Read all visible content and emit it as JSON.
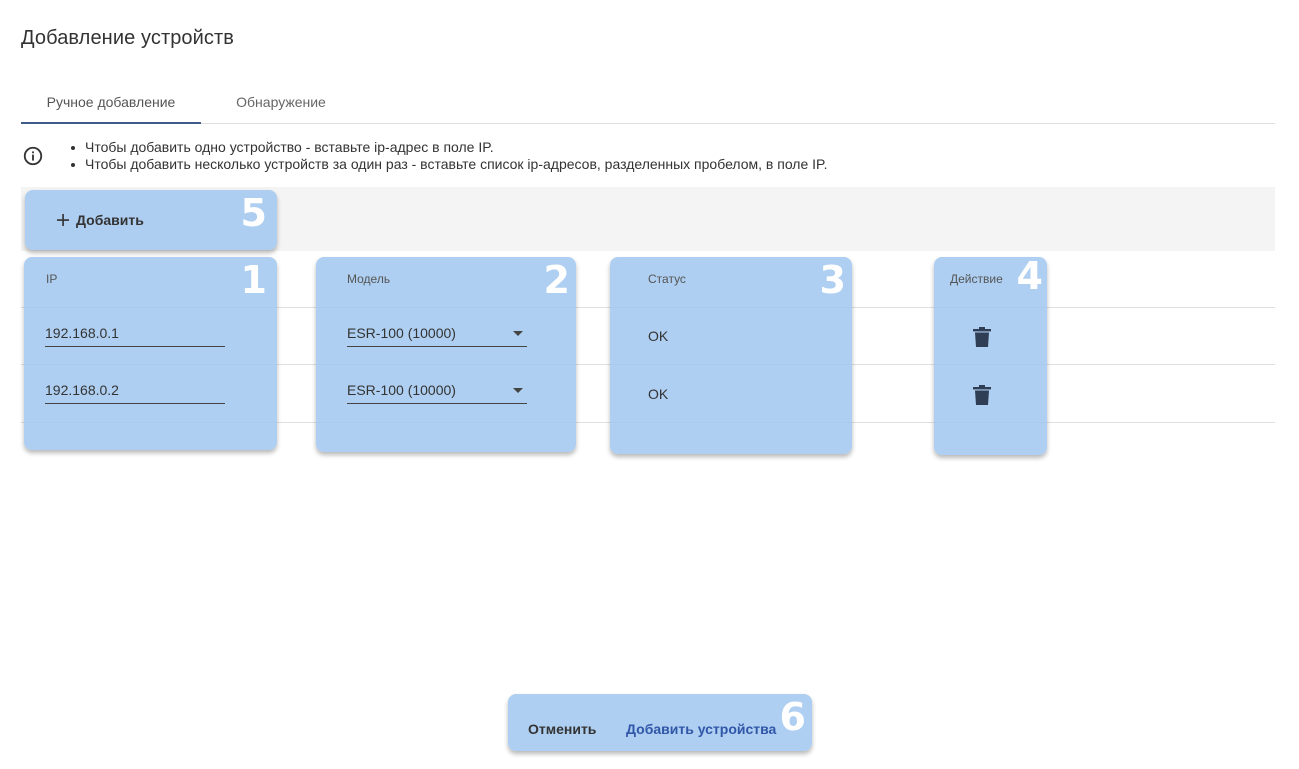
{
  "dialog": {
    "title": "Добавление устройств"
  },
  "tabs": [
    {
      "label": "Ручное добавление",
      "active": true
    },
    {
      "label": "Обнаружение",
      "active": false
    }
  ],
  "hints": [
    "Чтобы добавить одно устройство - вставьте ip-адрес в поле IP.",
    "Чтобы добавить несколько устройств за один раз - вставьте список ip-адресов, разделенных пробелом, в поле IP."
  ],
  "toolbar": {
    "add_label": "Добавить"
  },
  "table": {
    "columns": [
      "IP",
      "Модель",
      "Статус",
      "Действие"
    ],
    "rows": [
      {
        "ip": "192.168.0.1",
        "model": "ESR-100 (10000)",
        "status": "OK"
      },
      {
        "ip": "192.168.0.2",
        "model": "ESR-100 (10000)",
        "status": "OK"
      }
    ]
  },
  "footer": {
    "cancel_label": "Отменить",
    "confirm_label": "Добавить устройства"
  },
  "callouts": [
    "1",
    "2",
    "3",
    "4",
    "5",
    "6"
  ],
  "colors": {
    "accent": "#3f5b8a",
    "link": "#3056a8",
    "highlight": "#a0c7ee"
  }
}
